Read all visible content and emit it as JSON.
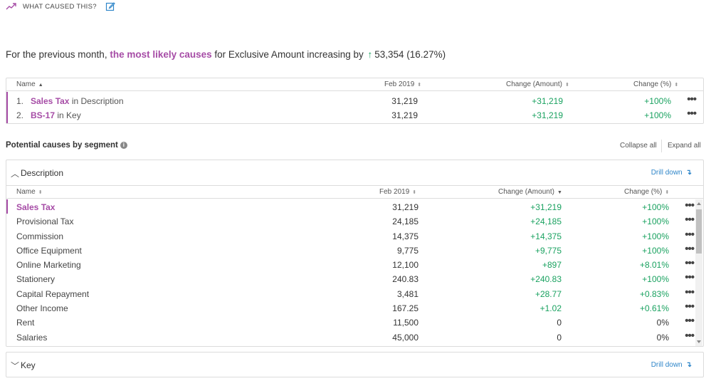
{
  "header": {
    "title": "WHAT CAUSED THIS?",
    "trend_icon": "trending-up-icon",
    "edit_icon": "edit-icon",
    "accent": "#a64ca6"
  },
  "summary": {
    "prefix": "For the previous month, ",
    "highlight": "the most likely causes",
    "middle": " for Exclusive Amount increasing by ",
    "arrow": "↑",
    "value": "53,354 (16.27%)"
  },
  "causes": {
    "columns": [
      "Name",
      "Feb 2019",
      "Change (Amount)",
      "Change (%)"
    ],
    "rows": [
      {
        "index": "1.",
        "name": "Sales Tax",
        "context": "in Description",
        "feb": "31,219",
        "change": "+31,219",
        "pct": "+100%"
      },
      {
        "index": "2.",
        "name": "BS-17",
        "context": "in Key",
        "feb": "31,219",
        "change": "+31,219",
        "pct": "+100%"
      }
    ]
  },
  "segments": {
    "title": "Potential causes by segment",
    "collapse_all": "Collapse all",
    "expand_all": "Expand all",
    "drill_down": "Drill down",
    "drill_icon": "↴",
    "panels": [
      {
        "title": "Description",
        "expanded": true,
        "columns": [
          "Name",
          "Feb 2019",
          "Change (Amount)",
          "Change (%)"
        ],
        "rows": [
          {
            "name": "Sales Tax",
            "feb": "31,219",
            "change": "+31,219",
            "pct": "+100%"
          },
          {
            "name": "Provisional Tax",
            "feb": "24,185",
            "change": "+24,185",
            "pct": "+100%"
          },
          {
            "name": "Commission",
            "feb": "14,375",
            "change": "+14,375",
            "pct": "+100%"
          },
          {
            "name": "Office Equipment",
            "feb": "9,775",
            "change": "+9,775",
            "pct": "+100%"
          },
          {
            "name": "Online Marketing",
            "feb": "12,100",
            "change": "+897",
            "pct": "+8.01%"
          },
          {
            "name": "Stationery",
            "feb": "240.83",
            "change": "+240.83",
            "pct": "+100%"
          },
          {
            "name": "Capital Repayment",
            "feb": "3,481",
            "change": "+28.77",
            "pct": "+0.83%"
          },
          {
            "name": "Other Income",
            "feb": "167.25",
            "change": "+1.02",
            "pct": "+0.61%"
          },
          {
            "name": "Rent",
            "feb": "11,500",
            "change": "0",
            "pct": "0%"
          },
          {
            "name": "Salaries",
            "feb": "45,000",
            "change": "0",
            "pct": "0%"
          }
        ]
      },
      {
        "title": "Key",
        "expanded": false
      }
    ]
  },
  "colors": {
    "accent": "#a64ca6",
    "positive": "#1aa260",
    "link": "#2f86c9"
  }
}
